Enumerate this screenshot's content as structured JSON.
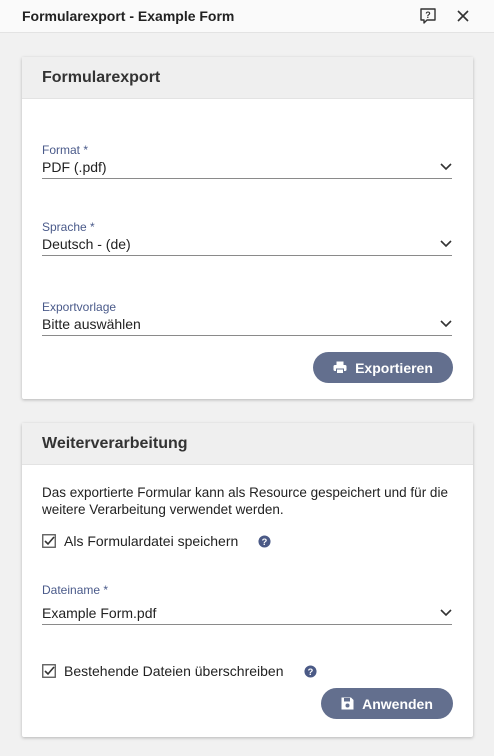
{
  "window": {
    "title": "Formularexport - Example Form"
  },
  "export_card": {
    "title": "Formularexport",
    "format": {
      "label": "Format *",
      "value": "PDF (.pdf)"
    },
    "language": {
      "label": "Sprache *",
      "value": "Deutsch - (de)"
    },
    "template": {
      "label": "Exportvorlage",
      "value": "Bitte auswählen"
    },
    "export_button": "Exportieren"
  },
  "processing_card": {
    "title": "Weiterverarbeitung",
    "description": "Das exportierte Formular kann als Resource gespeichert und für die weitere Verarbeitung verwendet werden.",
    "save_as_file": {
      "label": "Als Formulardatei speichern",
      "checked": true
    },
    "filename": {
      "label": "Dateiname *",
      "value": "Example Form.pdf"
    },
    "overwrite": {
      "label": "Bestehende Dateien überschreiben",
      "checked": true
    },
    "apply_button": "Anwenden"
  },
  "colors": {
    "accent": "#636f8e",
    "label": "#4a5a8a",
    "help_icon": "#4b5a86"
  }
}
